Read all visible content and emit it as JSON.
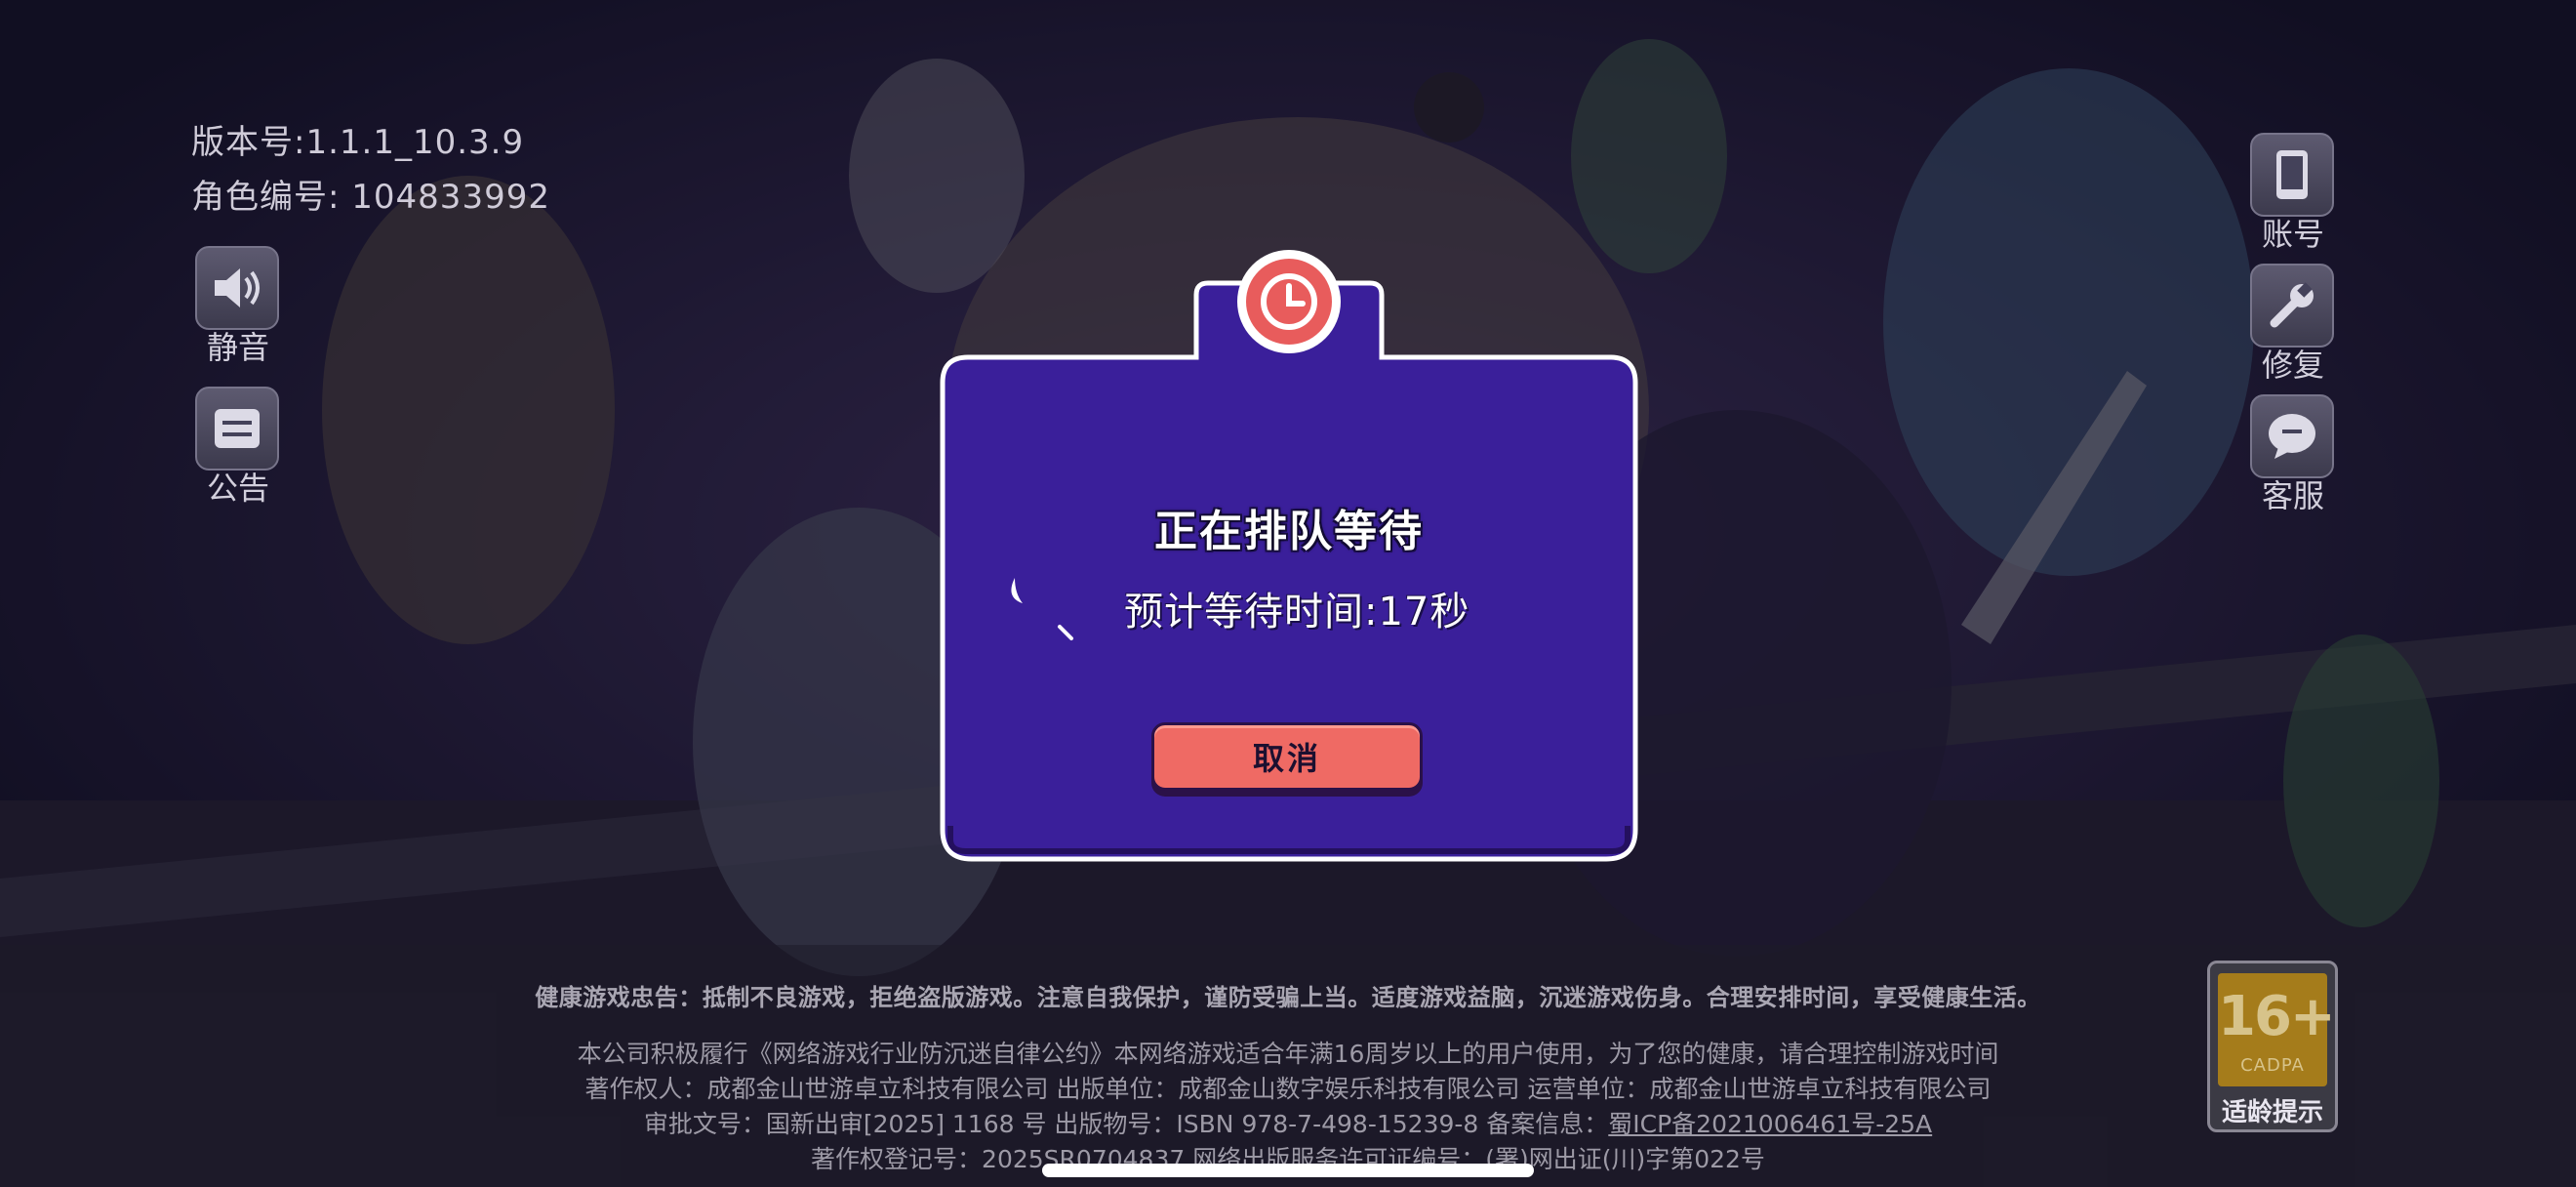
{
  "version": {
    "label": "版本号:",
    "value": "1.1.1_10.3.9"
  },
  "role": {
    "label": "角色编号:",
    "value": "104833992"
  },
  "left_buttons": [
    {
      "label": "静音",
      "icon": "speaker-icon"
    },
    {
      "label": "公告",
      "icon": "notice-icon"
    }
  ],
  "right_buttons": [
    {
      "label": "账号",
      "icon": "phone-icon"
    },
    {
      "label": "修复",
      "icon": "wrench-icon"
    },
    {
      "label": "客服",
      "icon": "chat-bubble-icon"
    }
  ],
  "dialog": {
    "title": "正在排队等待",
    "wait_text": "预计等待时间:17秒",
    "cancel_label": "取消",
    "icon": "clock-icon"
  },
  "footer": {
    "notice": "健康游戏忠告：抵制不良游戏，拒绝盗版游戏。注意自我保护，谨防受骗上当。适度游戏益脑，沉迷游戏伤身。合理安排时间，享受健康生活。",
    "line1": "本公司积极履行《网络游戏行业防沉迷自律公约》本网络游戏适合年满16周岁以上的用户使用，为了您的健康，请合理控制游戏时间",
    "line2": "著作权人：成都金山世游卓立科技有限公司 出版单位：成都金山数字娱乐科技有限公司 运营单位：成都金山世游卓立科技有限公司",
    "line3_prefix": "审批文号：国新出审[2025] 1168 号 出版物号：ISBN 978-7-498-15239-8 备案信息：",
    "line3_link": "蜀ICP备2021006461号-25A",
    "line4": "著作权登记号：2025SR0704837 网络出版服务许可证编号：(署)网出证(川)字第022号"
  },
  "age_rating": {
    "value": "16+",
    "org": "CADPA",
    "tip": "适龄提示"
  },
  "colors": {
    "dialog_bg": "#3a1f9a",
    "cancel_bg": "#ef6a64",
    "clock_bg": "#e85c5c"
  }
}
